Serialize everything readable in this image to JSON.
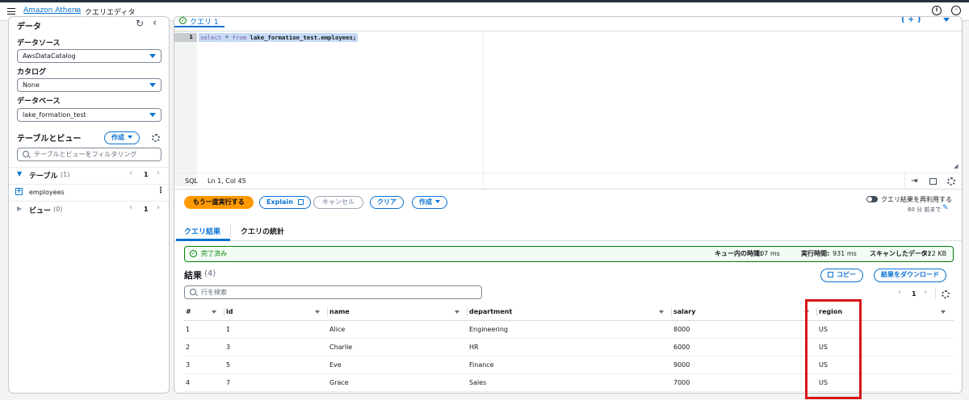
{
  "topbar": {
    "breadcrumb_link": "Amazon Athena",
    "breadcrumb_current": "クエリエディタ"
  },
  "left": {
    "data_title": "データ",
    "datasource_label": "データソース",
    "datasource_value": "AwsDataCatalog",
    "catalog_label": "カタログ",
    "catalog_value": "None",
    "database_label": "データベース",
    "database_value": "lake_formation_test",
    "tables_views_title": "テーブルとビュー",
    "create_button": "作成",
    "filter_placeholder": "テーブルとビューをフィルタリング",
    "tables_label": "テーブル",
    "tables_count": "(1)",
    "tables_page": "1",
    "table_item": "employees",
    "views_label": "ビュー",
    "views_count": "(0)",
    "views_page": "1"
  },
  "editor": {
    "tab_label": "クエリ 1",
    "line_number": "1",
    "sql_kw1": "select",
    "sql_rest1": " * ",
    "sql_kw2": "from",
    "sql_rest2": " lake_formation_test.employees;",
    "lang": "SQL",
    "cursor": "Ln 1, Col 45"
  },
  "actions": {
    "run_again": "もう一度実行する",
    "explain": "Explain",
    "cancel": "キャンセル",
    "clear": "クリア",
    "create": "作成",
    "reuse_label": "クエリ結果を再利用する",
    "reuse_sub": "60 分 前まで"
  },
  "result_tabs": {
    "results": "クエリ結果",
    "stats": "クエリの統計"
  },
  "status": {
    "state": "完了済み",
    "queue_label": "キュー内の時間:",
    "queue_value": "107 ms",
    "exec_label": "実行時間:",
    "exec_value": "931 ms",
    "scan_label": "スキャンしたデータ:",
    "scan_value": "0.22 KB"
  },
  "results": {
    "title": "結果",
    "count": "(4)",
    "copy": "コピー",
    "download": "結果をダウンロード",
    "search_placeholder": "行を検索",
    "page": "1",
    "columns": [
      "#",
      "id",
      "name",
      "department",
      "salary",
      "region"
    ],
    "rows": [
      [
        "1",
        "1",
        "Alice",
        "Engineering",
        "8000",
        "US"
      ],
      [
        "2",
        "3",
        "Charlie",
        "HR",
        "6000",
        "US"
      ],
      [
        "3",
        "5",
        "Eve",
        "Finance",
        "9000",
        "US"
      ],
      [
        "4",
        "7",
        "Grace",
        "Sales",
        "7000",
        "US"
      ]
    ]
  },
  "colors": {
    "accent": "#0972d3",
    "primary": "#ff9900",
    "success": "#037f0c",
    "highlight_box": "#d91515"
  }
}
